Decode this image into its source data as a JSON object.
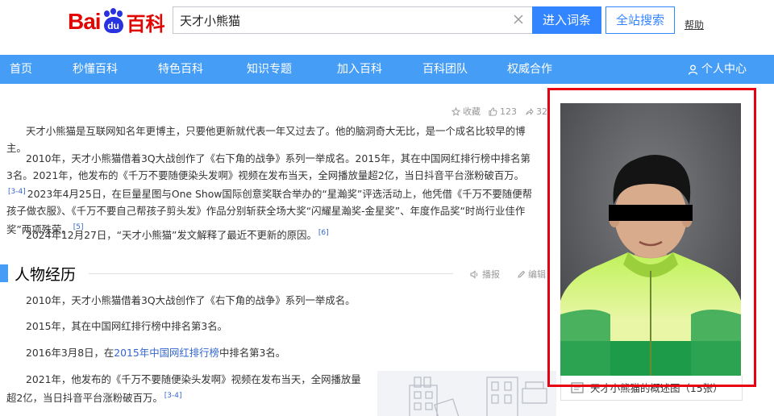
{
  "header": {
    "logo_left": "Bai",
    "logo_paw": "du",
    "logo_right": "百科",
    "search_value": "天才小熊猫",
    "enter_button": "进入词条",
    "site_search_button": "全站搜索",
    "help": "帮助"
  },
  "nav": {
    "items": [
      "首页",
      "秒懂百科",
      "特色百科",
      "知识专题",
      "加入百科",
      "百科团队",
      "权威合作"
    ],
    "user_center": "个人中心"
  },
  "actions": {
    "collect": "收藏",
    "like_count": "123",
    "share_count": "32"
  },
  "intro": {
    "p1": "天才小熊猫是互联网知名年更博主，只要他更新就代表一年又过去了。他的脑洞奇大无比，是一个成名比较早的博主。",
    "p2_a": "2010年，天才小熊猫借着3Q大战创作了《右下角的战争》系列一举成名。2015年，其在中国网红排行榜中排名第3名。2021年，他发布的《千万不要随便染头发啊》视频在发布当天，全网播放量超2亿，当日抖音平台涨粉破百万。",
    "p2_ref1": "[3-4]",
    "p2_b": "2023年4月25日，在巨量星图与One Show国际创意奖联合举办的“星瀚奖”评选活动上，他凭借《千万不要随便帮孩子做衣服》、《千万不要自己帮孩子剪头发》作品分别斩获全场大奖“闪耀星瀚奖-金星奖”、年度作品奖“时尚行业佳作奖”两项殊荣。",
    "p2_ref2": "[5]",
    "p3": "2024年12月27日，“天才小熊猫”发文解释了最近不更新的原因。",
    "p3_ref": "[6]"
  },
  "section": {
    "title": "人物经历",
    "play": "播报",
    "edit": "编辑",
    "e1": "2010年，天才小熊猫借着3Q大战创作了《右下角的战争》系列一举成名。",
    "e2": "2015年，其在中国网红排行榜中排名第3名。",
    "e3_a": "2016年3月8日，在",
    "e3_link": "2015年中国网红排行榜",
    "e3_b": "中排名第3名。",
    "e4": "2021年，他发布的《千万不要随便染头发啊》视频在发布当天，全网播放量超2亿，当日抖音平台涨粉破百万。",
    "e4_ref": "[3-4]"
  },
  "image_card": {
    "caption": "天才小熊猫的概述图（15张）"
  },
  "colors": {
    "nav_blue": "#459df5",
    "button_blue": "#3385ff",
    "logo_red": "#e10601",
    "logo_blue": "#2932e1",
    "highlight_red": "#e60012",
    "link_blue": "#3366cc"
  }
}
